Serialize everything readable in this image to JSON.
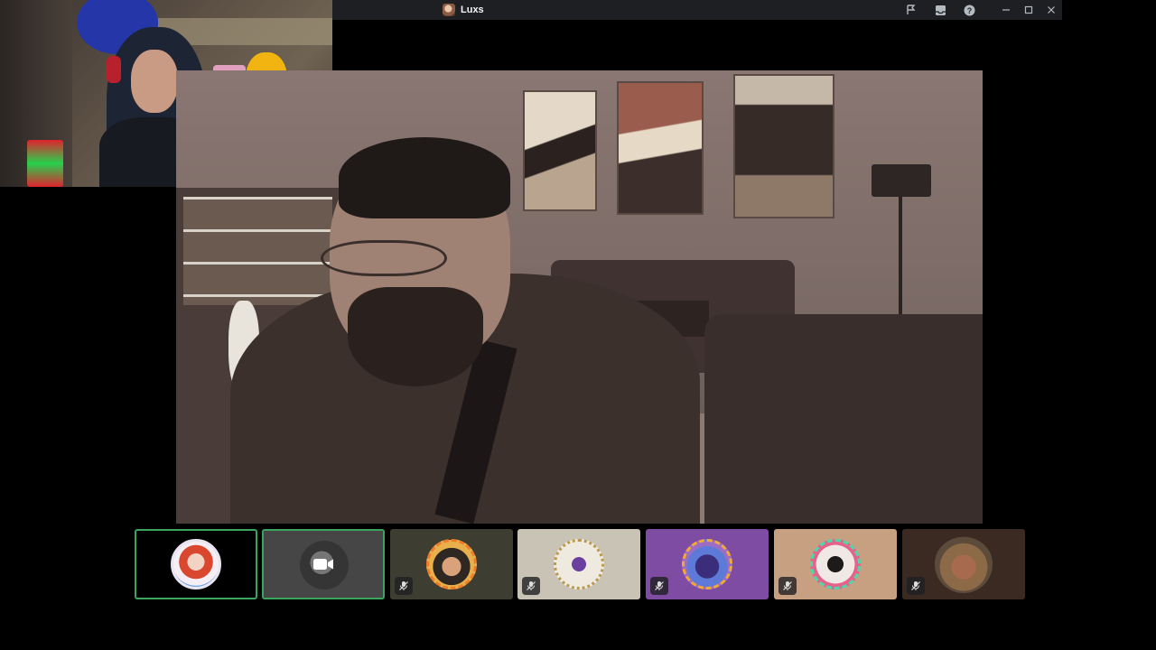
{
  "window": {
    "title": "Luxs",
    "icons": [
      "flag-icon",
      "inbox-icon",
      "help-icon",
      "minimize-icon",
      "maximize-icon",
      "close-icon"
    ]
  },
  "participants": [
    {
      "name_icon": "avatar",
      "bg": "#c94a4a",
      "ring": "#e8e4f0",
      "state": "speaking"
    },
    {
      "name_icon": "camera-icon",
      "bg": "#464646",
      "ring": "none",
      "state": "speaking-camera"
    },
    {
      "name_icon": "avatar",
      "bg": "#3e3d31",
      "ring": "#f07b2a",
      "state": "muted"
    },
    {
      "name_icon": "avatar",
      "bg": "#c9c3b5",
      "ring": "#b99a4a",
      "state": "muted"
    },
    {
      "name_icon": "avatar",
      "bg": "#7e4ca2",
      "ring": "#f2a93a",
      "state": "muted"
    },
    {
      "name_icon": "avatar",
      "bg": "#c6a080",
      "ring": "#4fd6a9",
      "state": "muted"
    },
    {
      "name_icon": "avatar",
      "bg": "#3a2a22",
      "ring": "none",
      "state": "muted"
    }
  ],
  "colors": {
    "speaking_border": "#3ba55d",
    "titlebar": "#1e1f22"
  }
}
